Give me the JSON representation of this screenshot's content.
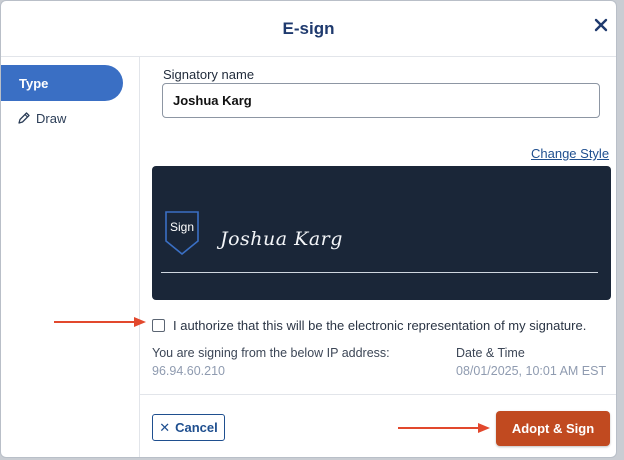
{
  "dialog": {
    "title": "E-sign",
    "close_icon": "close-icon"
  },
  "sidebar": {
    "items": [
      {
        "label": "Type",
        "active": true
      },
      {
        "label": "Draw",
        "icon": "pen-icon",
        "active": false
      }
    ]
  },
  "form": {
    "signatory_label": "Signatory name",
    "signatory_value": "Joshua Karg",
    "change_style": "Change Style",
    "signature_badge": "Sign",
    "signature_preview": "Joshua Karg",
    "authorize_checked": false,
    "authorize_text": "I authorize that this will be the electronic representation of my signature.",
    "ip_label": "You are signing from the below IP address:",
    "ip_value": "96.94.60.210",
    "datetime_label": "Date & Time",
    "datetime_value": "08/01/2025, 10:01 AM EST"
  },
  "footer": {
    "cancel_label": "Cancel",
    "adopt_label": "Adopt & Sign"
  },
  "colors": {
    "accent": "#3a6fc4",
    "preview_bg": "#1a2638",
    "primary_button": "#c14a20",
    "annotation_arrow": "#e2482d"
  }
}
